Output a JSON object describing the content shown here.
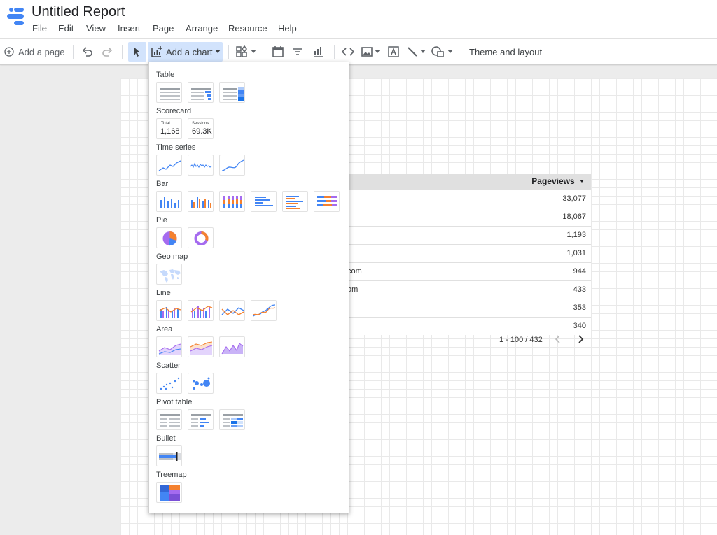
{
  "header": {
    "title": "Untitled Report",
    "menu": [
      "File",
      "Edit",
      "View",
      "Insert",
      "Page",
      "Arrange",
      "Resource",
      "Help"
    ]
  },
  "toolbar": {
    "add_page": "Add a page",
    "add_chart": "Add a chart",
    "theme": "Theme and layout"
  },
  "dropdown": {
    "sections": {
      "table": "Table",
      "scorecard": "Scorecard",
      "time_series": "Time series",
      "bar": "Bar",
      "pie": "Pie",
      "geo_map": "Geo map",
      "line": "Line",
      "area": "Area",
      "scatter": "Scatter",
      "pivot_table": "Pivot table",
      "bullet": "Bullet",
      "treemap": "Treemap"
    },
    "scorecard_items": [
      {
        "label": "Total",
        "value": "1,168"
      },
      {
        "label": "Sessions",
        "value": "69.3K"
      }
    ]
  },
  "table": {
    "header": "Pageviews",
    "rows": [
      {
        "left": "",
        "value": "33,077"
      },
      {
        "left": "",
        "value": "18,067"
      },
      {
        "left": "",
        "value": "1,193"
      },
      {
        "left": "",
        "value": "1,031"
      },
      {
        "left": "com",
        "value": "944"
      },
      {
        "left": "om",
        "value": "433"
      },
      {
        "left": "",
        "value": "353"
      },
      {
        "left": "",
        "value": "340"
      }
    ],
    "pagination": "1 - 100 / 432"
  },
  "colors": {
    "accent": "#4285f4",
    "orange": "#f4812f",
    "purple": "#a56bef",
    "active_bg": "#d2e3fc"
  }
}
